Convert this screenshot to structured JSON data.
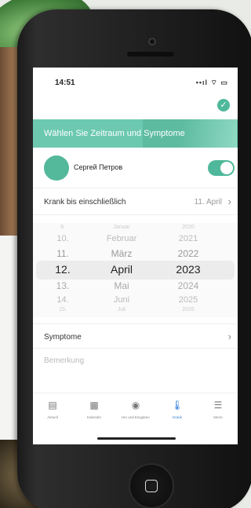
{
  "status_bar": {
    "time": "14:51",
    "icons": "••ıl ⌔ ▭"
  },
  "banner": {
    "text": "Wählen Sie Zeitraum und Symptome"
  },
  "profile": {
    "name": "Сергей Петров",
    "toggle_on": true
  },
  "sick_until": {
    "label": "Krank bis einschließlich",
    "value": "11. April"
  },
  "picker": {
    "days": [
      "9.",
      "10.",
      "11.",
      "12.",
      "13.",
      "14.",
      "15."
    ],
    "months": [
      "Januar",
      "Februar",
      "März",
      "April",
      "Mai",
      "Juni",
      "Juli"
    ],
    "years": [
      "2020",
      "2021",
      "2022",
      "2023",
      "2024",
      "2025",
      "2026"
    ],
    "selected": {
      "day": "12.",
      "month": "April",
      "year": "2023"
    }
  },
  "symptoms": {
    "label": "Symptome"
  },
  "note": {
    "placeholder": "Bemerkung"
  },
  "tabs": [
    {
      "label": "Aktuell",
      "icon": "current-icon"
    },
    {
      "label": "Kalender",
      "icon": "calendar-icon"
    },
    {
      "label": "Hin und Eingaben",
      "icon": "circle-icon"
    },
    {
      "label": "Krank",
      "icon": "thermometer-icon"
    },
    {
      "label": "Menü",
      "icon": "menu-icon"
    }
  ],
  "colors": {
    "accent": "#4fb89a",
    "banner": "#6cc9b0",
    "active_tab": "#2a7bd8"
  }
}
